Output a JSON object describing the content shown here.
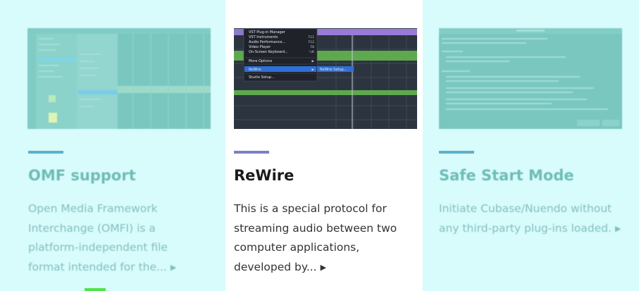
{
  "colors": {
    "card_tint": "#d8fbfc",
    "teal_title": "#1a8a80",
    "teal_text": "#3b8f8a",
    "accent_teal": "#5fb0c9",
    "accent_purple": "#7a80c6",
    "dark_title": "#1b1b1b",
    "dark_text": "#333333",
    "bottom_tab_green": "#4ee44a"
  },
  "cards": [
    {
      "title": "OMF support",
      "description": "Open Media Framework Interchange (OMFI) is a platform-independent file format intended for the...",
      "icon": "chevron-right-icon"
    },
    {
      "title": "ReWire",
      "description": "This is a special protocol for streaming audio between two computer applications, developed by...",
      "icon": "chevron-right-icon",
      "screenshot_menu": {
        "items": [
          {
            "label": "VST Plug-in Manager",
            "shortcut": ""
          },
          {
            "label": "VST Instruments",
            "shortcut": "F11"
          },
          {
            "label": "Audio Performance...",
            "shortcut": "F12"
          },
          {
            "label": "Video Player",
            "shortcut": "F8"
          },
          {
            "label": "On-Screen Keyboard...",
            "shortcut": "⌥K"
          },
          {
            "label": "More Options",
            "shortcut": "▶"
          },
          {
            "label": "ReWire",
            "shortcut": "▶"
          },
          {
            "label": "Studio Setup...",
            "shortcut": ""
          }
        ],
        "submenu_item": "ReWire Setup..."
      }
    },
    {
      "title": "Safe Start Mode",
      "description": "Initiate Cubase/Nuendo without any third-party plug-ins loaded.",
      "icon": "chevron-right-icon"
    }
  ]
}
